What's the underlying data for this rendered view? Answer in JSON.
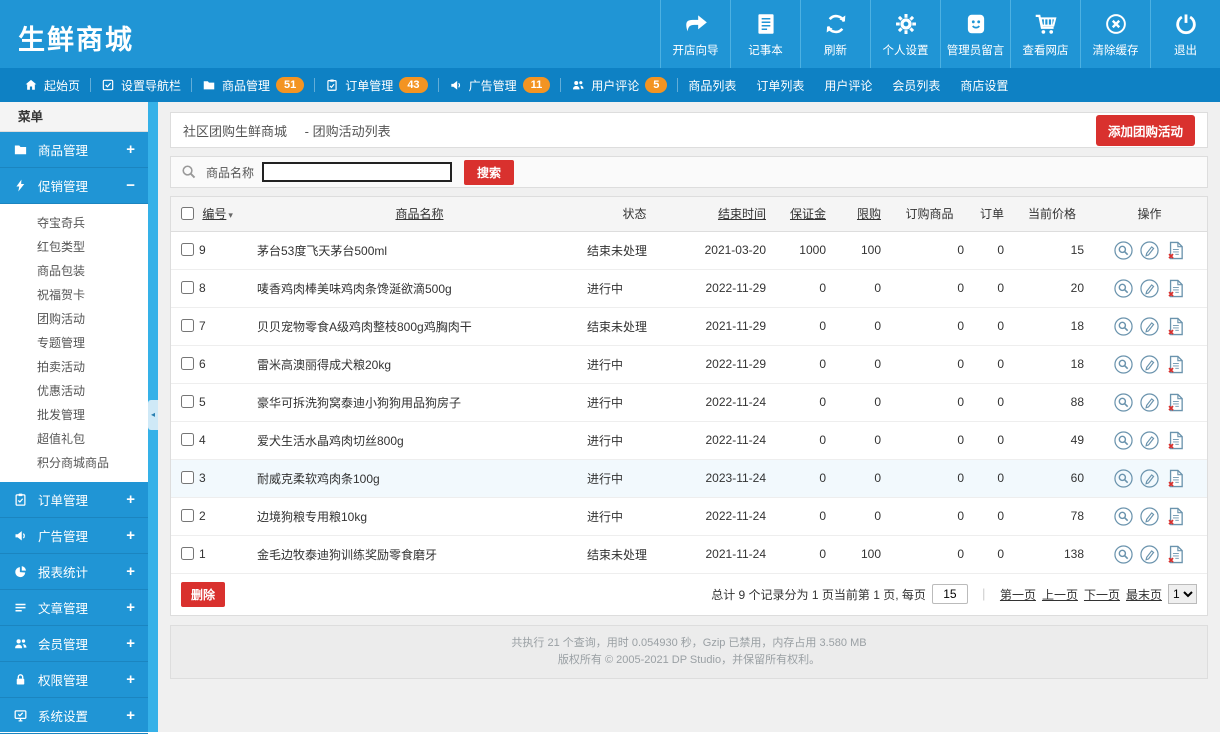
{
  "app": {
    "title": "生鲜商城"
  },
  "colors": {
    "header_blue": "#2095d5",
    "navbar_blue": "#0e81c4",
    "badge_orange": "#f39422",
    "button_red": "#d9312e",
    "action_icon_blue": "#6a93ad"
  },
  "header": {
    "actions": [
      {
        "label": "开店向导",
        "icon": "redirect-arrow-icon"
      },
      {
        "label": "记事本",
        "icon": "notepad-icon"
      },
      {
        "label": "刷新",
        "icon": "refresh-icon"
      },
      {
        "label": "个人设置",
        "icon": "gear-icon"
      },
      {
        "label": "管理员留言",
        "icon": "smiley-icon"
      },
      {
        "label": "查看网店",
        "icon": "cart-icon"
      },
      {
        "label": "清除缓存",
        "icon": "clear-cache-icon"
      },
      {
        "label": "退出",
        "icon": "power-icon"
      }
    ]
  },
  "nav": {
    "items": [
      {
        "label": "起始页",
        "icon": "home-icon"
      },
      {
        "label": "设置导航栏",
        "icon": "checkbox-icon"
      },
      {
        "label": "商品管理",
        "icon": "folder-icon",
        "badge": "51"
      },
      {
        "label": "订单管理",
        "icon": "clipboard-icon",
        "badge": "43"
      },
      {
        "label": "广告管理",
        "icon": "speaker-icon",
        "badge": "11"
      },
      {
        "label": "用户评论",
        "icon": "users-icon",
        "badge": "5"
      },
      {
        "label": "商品列表"
      },
      {
        "label": "订单列表"
      },
      {
        "label": "用户评论"
      },
      {
        "label": "会员列表"
      },
      {
        "label": "商店设置"
      }
    ]
  },
  "sidebar": {
    "title": "菜单",
    "groups": [
      {
        "label": "商品管理",
        "icon": "folder-icon",
        "state": "+"
      },
      {
        "label": "促销管理",
        "icon": "lightning-icon",
        "state": "−",
        "children": [
          "夺宝奇兵",
          "红包类型",
          "商品包装",
          "祝福贺卡",
          "团购活动",
          "专题管理",
          "拍卖活动",
          "优惠活动",
          "批发管理",
          "超值礼包",
          "积分商城商品"
        ]
      },
      {
        "label": "订单管理",
        "icon": "clipboard-icon",
        "state": "+"
      },
      {
        "label": "广告管理",
        "icon": "speaker-icon",
        "state": "+"
      },
      {
        "label": "报表统计",
        "icon": "pie-icon",
        "state": "+"
      },
      {
        "label": "文章管理",
        "icon": "lines-icon",
        "state": "+"
      },
      {
        "label": "会员管理",
        "icon": "users-icon",
        "state": "+"
      },
      {
        "label": "权限管理",
        "icon": "lock-icon",
        "state": "+"
      },
      {
        "label": "系统设置",
        "icon": "monitor-icon",
        "state": "+"
      }
    ]
  },
  "breadcrumb": {
    "site": "社区团购生鲜商城",
    "page": "- 团购活动列表"
  },
  "toolbar": {
    "add_label": "添加团购活动"
  },
  "search": {
    "label": "商品名称",
    "value": "",
    "button": "搜索"
  },
  "table": {
    "headers": {
      "id": "编号",
      "name": "商品名称",
      "status": "状态",
      "end": "结束时间",
      "deposit": "保证金",
      "limit": "限购",
      "ordered": "订购商品",
      "orders": "订单",
      "price": "当前价格",
      "actions": "操作"
    },
    "rows": [
      {
        "id": "9",
        "name": "茅台53度飞天茅台500ml",
        "status": "结束未处理",
        "end": "2021-03-20",
        "deposit": "1000",
        "limit": "100",
        "ordered": "0",
        "orders": "0",
        "price": "15"
      },
      {
        "id": "8",
        "name": "唛香鸡肉棒美味鸡肉条馋涎欲滴500g",
        "status": "进行中",
        "end": "2022-11-29",
        "deposit": "0",
        "limit": "0",
        "ordered": "0",
        "orders": "0",
        "price": "20"
      },
      {
        "id": "7",
        "name": "贝贝宠物零食A级鸡肉整枝800g鸡胸肉干",
        "status": "结束未处理",
        "end": "2021-11-29",
        "deposit": "0",
        "limit": "0",
        "ordered": "0",
        "orders": "0",
        "price": "18"
      },
      {
        "id": "6",
        "name": "雷米高澳丽得成犬粮20kg",
        "status": "进行中",
        "end": "2022-11-29",
        "deposit": "0",
        "limit": "0",
        "ordered": "0",
        "orders": "0",
        "price": "18"
      },
      {
        "id": "5",
        "name": "豪华可拆洗狗窝泰迪小狗狗用品狗房子",
        "status": "进行中",
        "end": "2022-11-24",
        "deposit": "0",
        "limit": "0",
        "ordered": "0",
        "orders": "0",
        "price": "88"
      },
      {
        "id": "4",
        "name": "爱犬生活水晶鸡肉切丝800g",
        "status": "进行中",
        "end": "2022-11-24",
        "deposit": "0",
        "limit": "0",
        "ordered": "0",
        "orders": "0",
        "price": "49"
      },
      {
        "id": "3",
        "name": "耐威克柔软鸡肉条100g",
        "status": "进行中",
        "end": "2023-11-24",
        "deposit": "0",
        "limit": "0",
        "ordered": "0",
        "orders": "0",
        "price": "60"
      },
      {
        "id": "2",
        "name": "边境狗粮专用粮10kg",
        "status": "进行中",
        "end": "2022-11-24",
        "deposit": "0",
        "limit": "0",
        "ordered": "0",
        "orders": "0",
        "price": "78"
      },
      {
        "id": "1",
        "name": "金毛边牧泰迪狗训练奖励零食磨牙",
        "status": "结束未处理",
        "end": "2021-11-24",
        "deposit": "0",
        "limit": "100",
        "ordered": "0",
        "orders": "0",
        "price": "138"
      }
    ],
    "delete_label": "删除"
  },
  "pagination": {
    "summary": "总计 9 个记录分为 1 页当前第 1 页, 每页",
    "per_page": "15",
    "first": "第一页",
    "prev": "上一页",
    "next": "下一页",
    "last": "最末页",
    "page": "1"
  },
  "footer": {
    "line1": "共执行 21 个查询，用时 0.054930 秒，Gzip 已禁用，内存占用 3.580 MB",
    "line2": "版权所有 © 2005-2021 DP Studio，并保留所有权利。"
  }
}
